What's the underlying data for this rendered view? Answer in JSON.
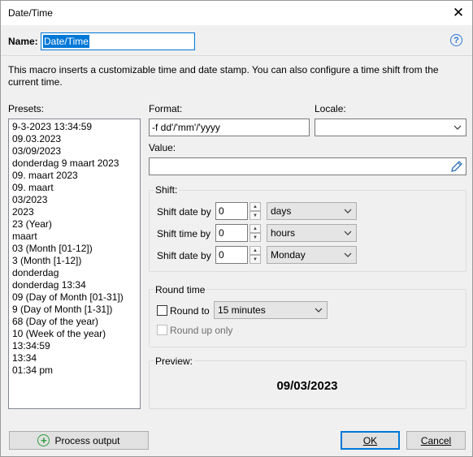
{
  "window": {
    "title": "Date/Time"
  },
  "name": {
    "label": "Name:",
    "value": "Date/Time"
  },
  "description": "This macro inserts a customizable time and date stamp. You can also configure a time shift from the current time.",
  "presets": {
    "label": "Presets:",
    "items": [
      "9-3-2023 13:34:59",
      "09.03.2023",
      "03/09/2023",
      "donderdag 9 maart 2023",
      "09. maart 2023",
      "09. maart",
      "03/2023",
      "2023",
      "23 (Year)",
      "maart",
      "03 (Month [01-12])",
      "3 (Month [1-12])",
      "donderdag",
      "donderdag 13:34",
      "09 (Day of Month [01-31])",
      "9 (Day of Month [1-31])",
      "68 (Day of the year)",
      "10 (Week of the year)",
      "13:34:59",
      "13:34",
      "01:34 pm"
    ]
  },
  "format": {
    "label": "Format:",
    "value": "-f dd'/'mm'/'yyyy"
  },
  "locale": {
    "label": "Locale:",
    "value": ""
  },
  "value": {
    "label": "Value:",
    "value": ""
  },
  "shift": {
    "title": "Shift:",
    "date": {
      "label": "Shift date by",
      "amount": "0",
      "unit": "days"
    },
    "time": {
      "label": "Shift time by",
      "amount": "0",
      "unit": "hours"
    },
    "day": {
      "label": "Shift date by",
      "amount": "0",
      "unit": "Monday"
    }
  },
  "round": {
    "title": "Round time",
    "round_to_label": "Round to",
    "round_to_value": "15 minutes",
    "round_up_label": "Round up only"
  },
  "preview": {
    "label": "Preview:",
    "value": "09/03/2023"
  },
  "buttons": {
    "process": "Process output",
    "ok": "OK",
    "cancel": "Cancel"
  },
  "icons": {
    "close": "close-icon",
    "help": "help-icon",
    "pencil": "pencil-icon",
    "add": "plus-circle-icon",
    "dropdown": "chevron-down-icon"
  },
  "colors": {
    "accent": "#0078d7",
    "add_icon": "#2e9a3a"
  }
}
